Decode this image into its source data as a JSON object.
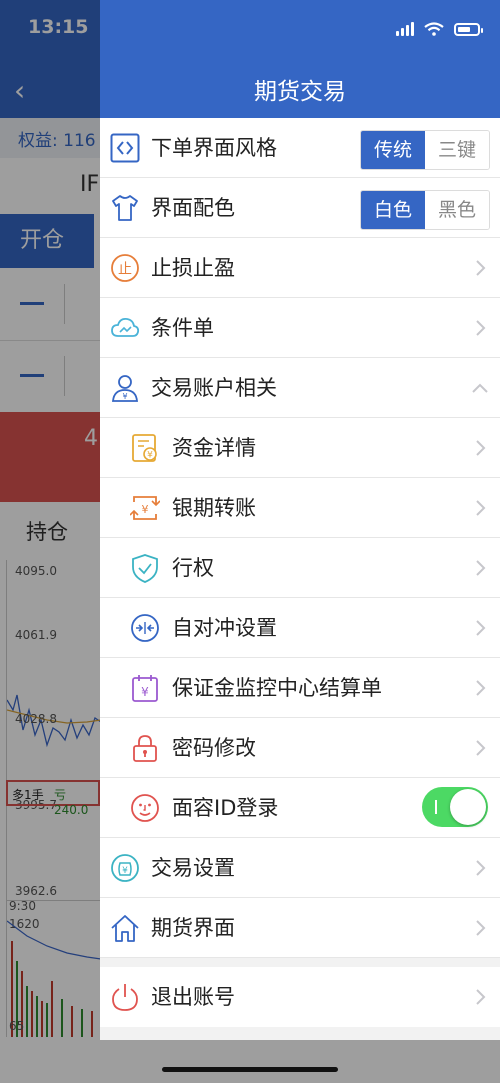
{
  "status_bar": {
    "time": "13:15"
  },
  "background": {
    "equity_label": "权益: 116",
    "contract": "IF",
    "open_tab": "开仓",
    "red_value": "4",
    "position_label": "持仓",
    "chart_prices": [
      "4095.0",
      "4061.9",
      "4028.8",
      "3995.7",
      "3962.6"
    ],
    "time_label": "9:30",
    "vol_label": "1620",
    "vol_bottom": "65",
    "position_tag_side": "多1手",
    "position_tag_pnl": "亏240.0"
  },
  "drawer": {
    "title": "期货交易",
    "order_style": {
      "label": "下单界面风格",
      "option_selected": "传统",
      "option_other": "三键"
    },
    "color_scheme": {
      "label": "界面配色",
      "option_selected": "白色",
      "option_other": "黑色"
    },
    "items": {
      "stop_loss": "止损止盈",
      "conditional_order": "条件单",
      "account_related": "交易账户相关",
      "fund_details": "资金详情",
      "bank_transfer": "银期转账",
      "exercise": "行权",
      "self_hedge": "自对冲设置",
      "margin_statement": "保证金监控中心结算单",
      "change_password": "密码修改",
      "face_id": "面容ID登录",
      "trade_settings": "交易设置",
      "futures_interface": "期货界面",
      "logout": "退出账号"
    },
    "face_id_enabled": true,
    "colors": {
      "header": "#3566c4",
      "toggle_on": "#4cd964"
    }
  }
}
